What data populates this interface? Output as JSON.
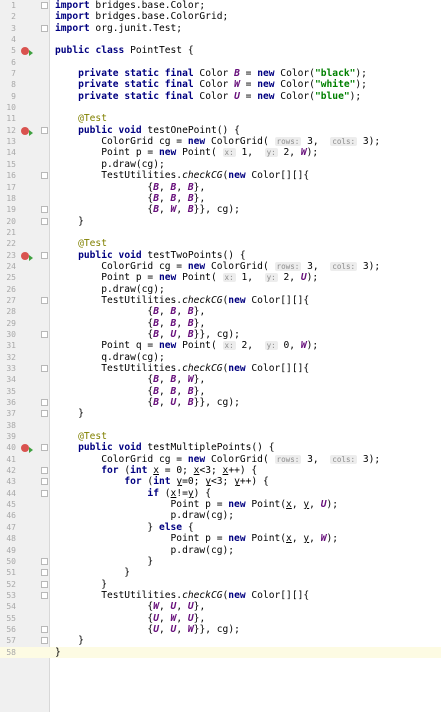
{
  "editor": {
    "lines": [
      {
        "n": "1",
        "mk": false,
        "fold": true,
        "t": "import bridges.base.Color;"
      },
      {
        "n": "2",
        "mk": false,
        "fold": false,
        "t": "import bridges.base.ColorGrid;"
      },
      {
        "n": "3",
        "mk": false,
        "fold": true,
        "t": "import org.junit.Test;"
      },
      {
        "n": "4",
        "mk": false,
        "fold": false,
        "t": ""
      },
      {
        "n": "5",
        "mk": true,
        "fold": false,
        "t": "public class PointTest {"
      },
      {
        "n": "6",
        "mk": false,
        "fold": false,
        "t": ""
      },
      {
        "n": "7",
        "mk": false,
        "fold": false,
        "t": "    private static final Color B = new Color(\"black\");"
      },
      {
        "n": "8",
        "mk": false,
        "fold": false,
        "t": "    private static final Color W = new Color(\"white\");"
      },
      {
        "n": "9",
        "mk": false,
        "fold": false,
        "t": "    private static final Color U = new Color(\"blue\");"
      },
      {
        "n": "10",
        "mk": false,
        "fold": false,
        "t": ""
      },
      {
        "n": "11",
        "mk": false,
        "fold": false,
        "t": "    @Test"
      },
      {
        "n": "12",
        "mk": true,
        "fold": true,
        "t": "    public void testOnePoint() {"
      },
      {
        "n": "13",
        "mk": false,
        "fold": false,
        "t": "        ColorGrid cg = new ColorGrid( rows: 3,  cols: 3);"
      },
      {
        "n": "14",
        "mk": false,
        "fold": false,
        "t": "        Point p = new Point( x: 1,  y: 2, W);"
      },
      {
        "n": "15",
        "mk": false,
        "fold": false,
        "t": "        p.draw(cg);"
      },
      {
        "n": "16",
        "mk": false,
        "fold": true,
        "t": "        TestUtilities.checkCG(new Color[][]{"
      },
      {
        "n": "17",
        "mk": false,
        "fold": false,
        "t": "                {B, B, B},"
      },
      {
        "n": "18",
        "mk": false,
        "fold": false,
        "t": "                {B, B, B},"
      },
      {
        "n": "19",
        "mk": false,
        "fold": true,
        "t": "                {B, W, B}}, cg);"
      },
      {
        "n": "20",
        "mk": false,
        "fold": true,
        "t": "    }"
      },
      {
        "n": "21",
        "mk": false,
        "fold": false,
        "t": ""
      },
      {
        "n": "22",
        "mk": false,
        "fold": false,
        "t": "    @Test"
      },
      {
        "n": "23",
        "mk": true,
        "fold": true,
        "t": "    public void testTwoPoints() {"
      },
      {
        "n": "24",
        "mk": false,
        "fold": false,
        "t": "        ColorGrid cg = new ColorGrid( rows: 3,  cols: 3);"
      },
      {
        "n": "25",
        "mk": false,
        "fold": false,
        "t": "        Point p = new Point( x: 1,  y: 2, U);"
      },
      {
        "n": "26",
        "mk": false,
        "fold": false,
        "t": "        p.draw(cg);"
      },
      {
        "n": "27",
        "mk": false,
        "fold": true,
        "t": "        TestUtilities.checkCG(new Color[][]{"
      },
      {
        "n": "28",
        "mk": false,
        "fold": false,
        "t": "                {B, B, B},"
      },
      {
        "n": "29",
        "mk": false,
        "fold": false,
        "t": "                {B, B, B},"
      },
      {
        "n": "30",
        "mk": false,
        "fold": true,
        "t": "                {B, U, B}}, cg);"
      },
      {
        "n": "31",
        "mk": false,
        "fold": false,
        "t": "        Point q = new Point( x: 2,  y: 0, W);"
      },
      {
        "n": "32",
        "mk": false,
        "fold": false,
        "t": "        q.draw(cg);"
      },
      {
        "n": "33",
        "mk": false,
        "fold": true,
        "t": "        TestUtilities.checkCG(new Color[][]{"
      },
      {
        "n": "34",
        "mk": false,
        "fold": false,
        "t": "                {B, B, W},"
      },
      {
        "n": "35",
        "mk": false,
        "fold": false,
        "t": "                {B, B, B},"
      },
      {
        "n": "36",
        "mk": false,
        "fold": true,
        "t": "                {B, U, B}}, cg);"
      },
      {
        "n": "37",
        "mk": false,
        "fold": true,
        "t": "    }"
      },
      {
        "n": "38",
        "mk": false,
        "fold": false,
        "t": ""
      },
      {
        "n": "39",
        "mk": false,
        "fold": false,
        "t": "    @Test"
      },
      {
        "n": "40",
        "mk": true,
        "fold": true,
        "t": "    public void testMultiplePoints() {"
      },
      {
        "n": "41",
        "mk": false,
        "fold": false,
        "t": "        ColorGrid cg = new ColorGrid( rows: 3,  cols: 3);"
      },
      {
        "n": "42",
        "mk": false,
        "fold": true,
        "t": "        for (int x = 0; x<3; x++) {"
      },
      {
        "n": "43",
        "mk": false,
        "fold": true,
        "t": "            for (int y=0; y<3; y++) {"
      },
      {
        "n": "44",
        "mk": false,
        "fold": true,
        "t": "                if (x!=y) {"
      },
      {
        "n": "45",
        "mk": false,
        "fold": false,
        "t": "                    Point p = new Point(x, y, U);"
      },
      {
        "n": "46",
        "mk": false,
        "fold": false,
        "t": "                    p.draw(cg);"
      },
      {
        "n": "47",
        "mk": false,
        "fold": false,
        "t": "                } else {"
      },
      {
        "n": "48",
        "mk": false,
        "fold": false,
        "t": "                    Point p = new Point(x, y, W);"
      },
      {
        "n": "49",
        "mk": false,
        "fold": false,
        "t": "                    p.draw(cg);"
      },
      {
        "n": "50",
        "mk": false,
        "fold": true,
        "t": "                }"
      },
      {
        "n": "51",
        "mk": false,
        "fold": true,
        "t": "            }"
      },
      {
        "n": "52",
        "mk": false,
        "fold": true,
        "t": "        }"
      },
      {
        "n": "53",
        "mk": false,
        "fold": true,
        "t": "        TestUtilities.checkCG(new Color[][]{"
      },
      {
        "n": "54",
        "mk": false,
        "fold": false,
        "t": "                {W, U, U},"
      },
      {
        "n": "55",
        "mk": false,
        "fold": false,
        "t": "                {U, W, U},"
      },
      {
        "n": "56",
        "mk": false,
        "fold": true,
        "t": "                {U, U, W}}, cg);"
      },
      {
        "n": "57",
        "mk": false,
        "fold": true,
        "t": "    }"
      },
      {
        "n": "58",
        "mk": false,
        "fold": false,
        "t": "}"
      }
    ],
    "colors": {
      "keyword": "#000080",
      "string": "#008000",
      "field": "#660e7a",
      "annotation": "#808000",
      "marker": "#d9534f",
      "current_line": "#fdfbe3"
    }
  }
}
